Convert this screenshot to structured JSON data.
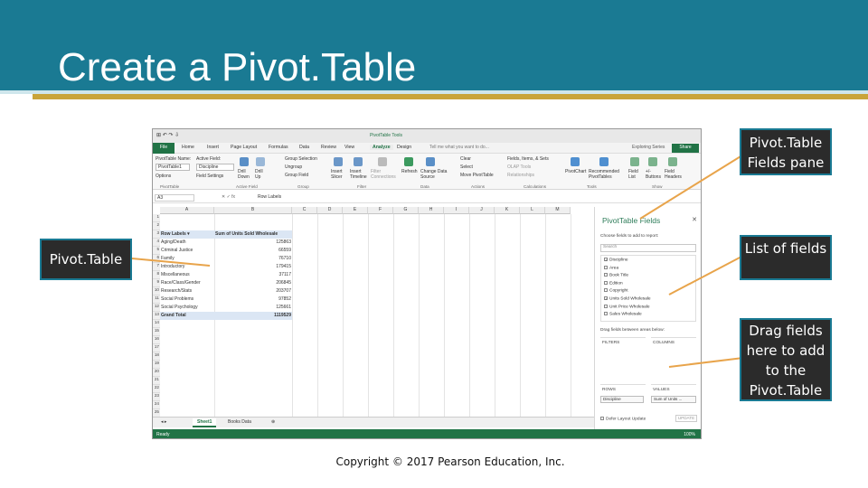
{
  "slide": {
    "title": "Create a Pivot.Table",
    "copyright": "Copyright © 2017 Pearson Education, Inc."
  },
  "callouts": {
    "fields_pane": "Pivot.Table Fields pane",
    "pivot": "Pivot.Table",
    "list": "List of fields",
    "drag": "Drag fields here to add to the Pivot.Table"
  },
  "colors": {
    "banner": "#1a7a93",
    "accent": "#c9a43a",
    "excel_green": "#217346",
    "callout_bg": "#2b2b2b",
    "leader": "#e8a44b"
  },
  "excel": {
    "tools_label": "PivotTable Tools",
    "qat": "⊞ ↶ ↷ ⇩",
    "tabs": [
      "File",
      "Home",
      "Insert",
      "Page Layout",
      "Formulas",
      "Data",
      "Review",
      "View",
      "Analyze",
      "Design"
    ],
    "tell_me": "Tell me what you want to do...",
    "user": "Exploring Series",
    "share": "Share",
    "ribbon": {
      "pt_name_label": "PivotTable Name:",
      "pt_name": "PivotTable1",
      "options": "Options",
      "active_field_label": "Active Field:",
      "active_field": "Discipline",
      "field_settings": "Field Settings",
      "drill_down": "Drill Down",
      "drill_up": "Drill Up",
      "group_selection": "Group Selection",
      "ungroup": "Ungroup",
      "group_field": "Group Field",
      "insert_slicer": "Insert Slicer",
      "insert_timeline": "Insert Timeline",
      "filter_connections": "Filter Connections",
      "refresh": "Refresh",
      "change_data_source": "Change Data Source",
      "clear": "Clear",
      "select": "Select",
      "move_pivottable": "Move PivotTable",
      "fields_items_sets": "Fields, Items, & Sets",
      "olap_tools": "OLAP Tools",
      "relationships": "Relationships",
      "pivotchart": "PivotChart",
      "recommended": "Recommended PivotTables",
      "field_list": "Field List",
      "buttons": "+/- Buttons",
      "field_headers": "Field Headers",
      "groups": [
        "PivotTable",
        "Active Field",
        "Group",
        "Filter",
        "Data",
        "Actions",
        "Calculations",
        "Tools",
        "Show"
      ]
    },
    "name_box": "A3",
    "fx": "✕ ✓ fx",
    "formula": "Row Labels",
    "columns": [
      "A",
      "B",
      "C",
      "D",
      "E",
      "F",
      "G",
      "H",
      "I",
      "J",
      "K",
      "L",
      "M"
    ],
    "rows": [
      "1",
      "2",
      "3",
      "4",
      "5",
      "6",
      "7",
      "8",
      "9",
      "10",
      "11",
      "12",
      "13",
      "14",
      "15",
      "16",
      "17",
      "18",
      "19",
      "20",
      "21",
      "22",
      "23",
      "24",
      "25"
    ],
    "pivot_header": {
      "label": "Row Labels",
      "value": "Sum of Units Sold Wholesale"
    },
    "pivot_rows": [
      {
        "label": "Aging/Death",
        "value": "125863"
      },
      {
        "label": "Criminal Justice",
        "value": "66559"
      },
      {
        "label": "Family",
        "value": "76710"
      },
      {
        "label": "Introductory",
        "value": "179415"
      },
      {
        "label": "Miscellaneous",
        "value": "37117"
      },
      {
        "label": "Race/Class/Gender",
        "value": "206845"
      },
      {
        "label": "Research/Stats",
        "value": "203707"
      },
      {
        "label": "Social Problems",
        "value": "97852"
      },
      {
        "label": "Social Psychology",
        "value": "125661"
      }
    ],
    "grand_total": {
      "label": "Grand Total",
      "value": "1119529"
    },
    "sheets": [
      "Sheet1",
      "Books Data"
    ],
    "status": "Ready",
    "zoom": "100%"
  },
  "pane": {
    "title": "PivotTable Fields",
    "choose": "Choose fields to add to report:",
    "search": "Search",
    "fields": [
      {
        "name": "Discipline",
        "checked": true
      },
      {
        "name": "Area",
        "checked": false
      },
      {
        "name": "Book Title",
        "checked": false
      },
      {
        "name": "Edition",
        "checked": false
      },
      {
        "name": "Copyright",
        "checked": false
      },
      {
        "name": "Units Sold Wholesale",
        "checked": true
      },
      {
        "name": "Unit Price Wholesale",
        "checked": false
      },
      {
        "name": "Sales Wholesale",
        "checked": false
      }
    ],
    "drag_label": "Drag fields between areas below:",
    "filters": "FILTERS",
    "columns": "COLUMNS",
    "rows": "ROWS",
    "values": "VALUES",
    "rows_item": "Discipline",
    "values_item": "Sum of Units ...",
    "defer": "Defer Layout Update",
    "update": "UPDATE"
  }
}
